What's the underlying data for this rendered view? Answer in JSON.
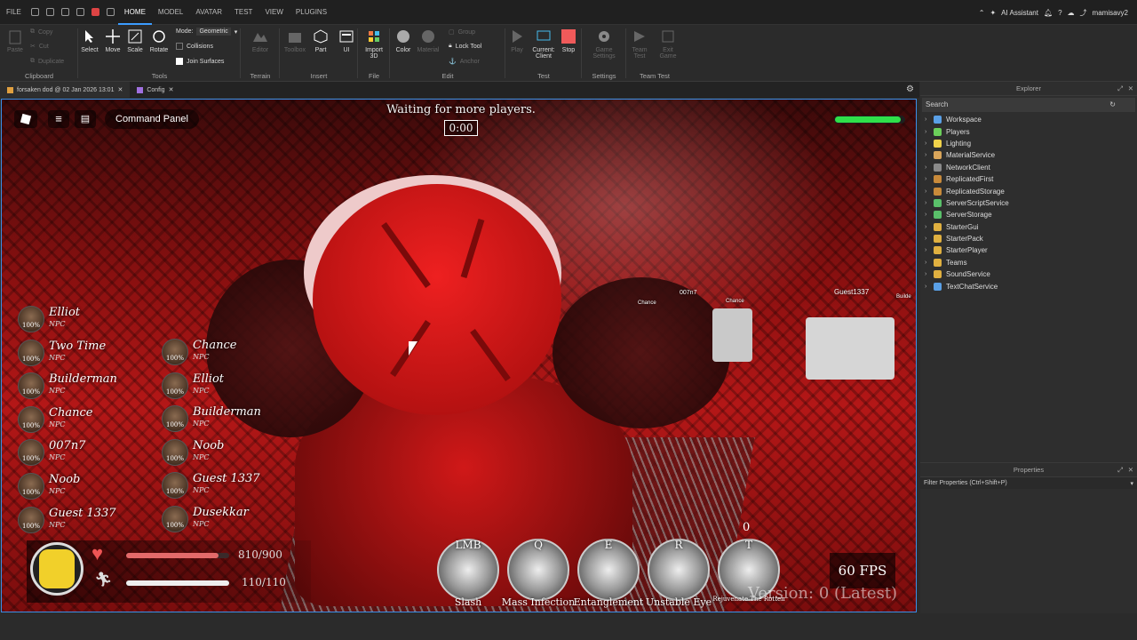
{
  "menubar": {
    "items": [
      "FILE",
      "HOME",
      "MODEL",
      "AVATAR",
      "TEST",
      "VIEW",
      "PLUGINS"
    ],
    "active": "HOME",
    "assistant": "AI Assistant",
    "user": "mamisavy2"
  },
  "ribbon": {
    "clipboard": {
      "label": "Clipboard",
      "paste": "Paste",
      "copy": "Copy",
      "cut": "Cut",
      "duplicate": "Duplicate"
    },
    "tools": {
      "label": "Tools",
      "select": "Select",
      "move": "Move",
      "scale": "Scale",
      "rotate": "Rotate",
      "mode_label": "Mode:",
      "mode_value": "Geometric",
      "collisions": "Collisions",
      "join_surfaces": "Join Surfaces"
    },
    "terrain": {
      "label": "Terrain",
      "editor": "Editor"
    },
    "insert": {
      "label": "Insert",
      "toolbox": "Toolbox",
      "part": "Part",
      "ui": "UI"
    },
    "file": {
      "label": "File",
      "import3d": "Import 3D"
    },
    "edit": {
      "label": "Edit",
      "color": "Color",
      "material": "Material",
      "group": "Group",
      "lock_tool": "Lock Tool",
      "anchor": "Anchor"
    },
    "test": {
      "label": "Test",
      "play": "Play",
      "current_client": "Current: Client",
      "stop": "Stop"
    },
    "settings": {
      "label": "Settings",
      "game_settings": "Game Settings"
    },
    "team_test": {
      "label": "Team Test",
      "team_test": "Team Test",
      "exit_game": "Exit Game"
    }
  },
  "tabs": [
    {
      "label": "forsaken dod @ 02 Jan 2026 13:01"
    },
    {
      "label": "Config"
    }
  ],
  "game": {
    "waiting": "Waiting for more players.",
    "timer": "0:00",
    "command_panel": "Command Panel",
    "health_fill": 0.95,
    "players_left": [
      {
        "name": "Elliot",
        "role": "NPC",
        "pct": "100%"
      },
      {
        "name": "Two Time",
        "role": "NPC",
        "pct": "100%"
      },
      {
        "name": "Builderman",
        "role": "NPC",
        "pct": "100%"
      },
      {
        "name": "Chance",
        "role": "NPC",
        "pct": "100%"
      },
      {
        "name": "007n7",
        "role": "NPC",
        "pct": "100%"
      },
      {
        "name": "Noob",
        "role": "NPC",
        "pct": "100%"
      },
      {
        "name": "Guest 1337",
        "role": "NPC",
        "pct": "100%"
      }
    ],
    "players_right": [
      {
        "name": "Chance",
        "role": "NPC",
        "pct": "100%"
      },
      {
        "name": "Elliot",
        "role": "NPC",
        "pct": "100%"
      },
      {
        "name": "Builderman",
        "role": "NPC",
        "pct": "100%"
      },
      {
        "name": "Noob",
        "role": "NPC",
        "pct": "100%"
      },
      {
        "name": "Guest 1337",
        "role": "NPC",
        "pct": "100%"
      },
      {
        "name": "Dusekkar",
        "role": "NPC",
        "pct": "100%"
      }
    ],
    "hp_text": "810/900",
    "hp_fill": 0.9,
    "stamina_text": "110/110",
    "stamina_fill": 1.0,
    "abilities": [
      {
        "key": "LMB",
        "name": "Slash"
      },
      {
        "key": "Q",
        "name": "Mass Infection"
      },
      {
        "key": "E",
        "name": "Entanglement"
      },
      {
        "key": "R",
        "name": "Unstable Eye"
      },
      {
        "key": "T",
        "name": "Rejuvenate The Rotten",
        "count": "0"
      }
    ],
    "fps": "60 FPS",
    "version": "Version: 0 (Latest)",
    "world_tags": [
      "007n7",
      "Chance",
      "Chance",
      "Guest1337",
      "Builde"
    ]
  },
  "explorer": {
    "title": "Explorer",
    "search_placeholder": "Search",
    "items": [
      {
        "name": "Workspace",
        "color": "#5aa0e6"
      },
      {
        "name": "Players",
        "color": "#6bcf5a"
      },
      {
        "name": "Lighting",
        "color": "#f0d24a"
      },
      {
        "name": "MaterialService",
        "color": "#d9a55a"
      },
      {
        "name": "NetworkClient",
        "color": "#8a8a8a"
      },
      {
        "name": "ReplicatedFirst",
        "color": "#c88a3a"
      },
      {
        "name": "ReplicatedStorage",
        "color": "#c88a3a"
      },
      {
        "name": "ServerScriptService",
        "color": "#5ac06a"
      },
      {
        "name": "ServerStorage",
        "color": "#5ac06a"
      },
      {
        "name": "StarterGui",
        "color": "#e0b040"
      },
      {
        "name": "StarterPack",
        "color": "#e0b040"
      },
      {
        "name": "StarterPlayer",
        "color": "#e0b040"
      },
      {
        "name": "Teams",
        "color": "#e0b040"
      },
      {
        "name": "SoundService",
        "color": "#e0b040"
      },
      {
        "name": "TextChatService",
        "color": "#5aa0e6"
      }
    ]
  },
  "properties": {
    "title": "Properties",
    "filter_placeholder": "Filter Properties (Ctrl+Shift+P)"
  }
}
